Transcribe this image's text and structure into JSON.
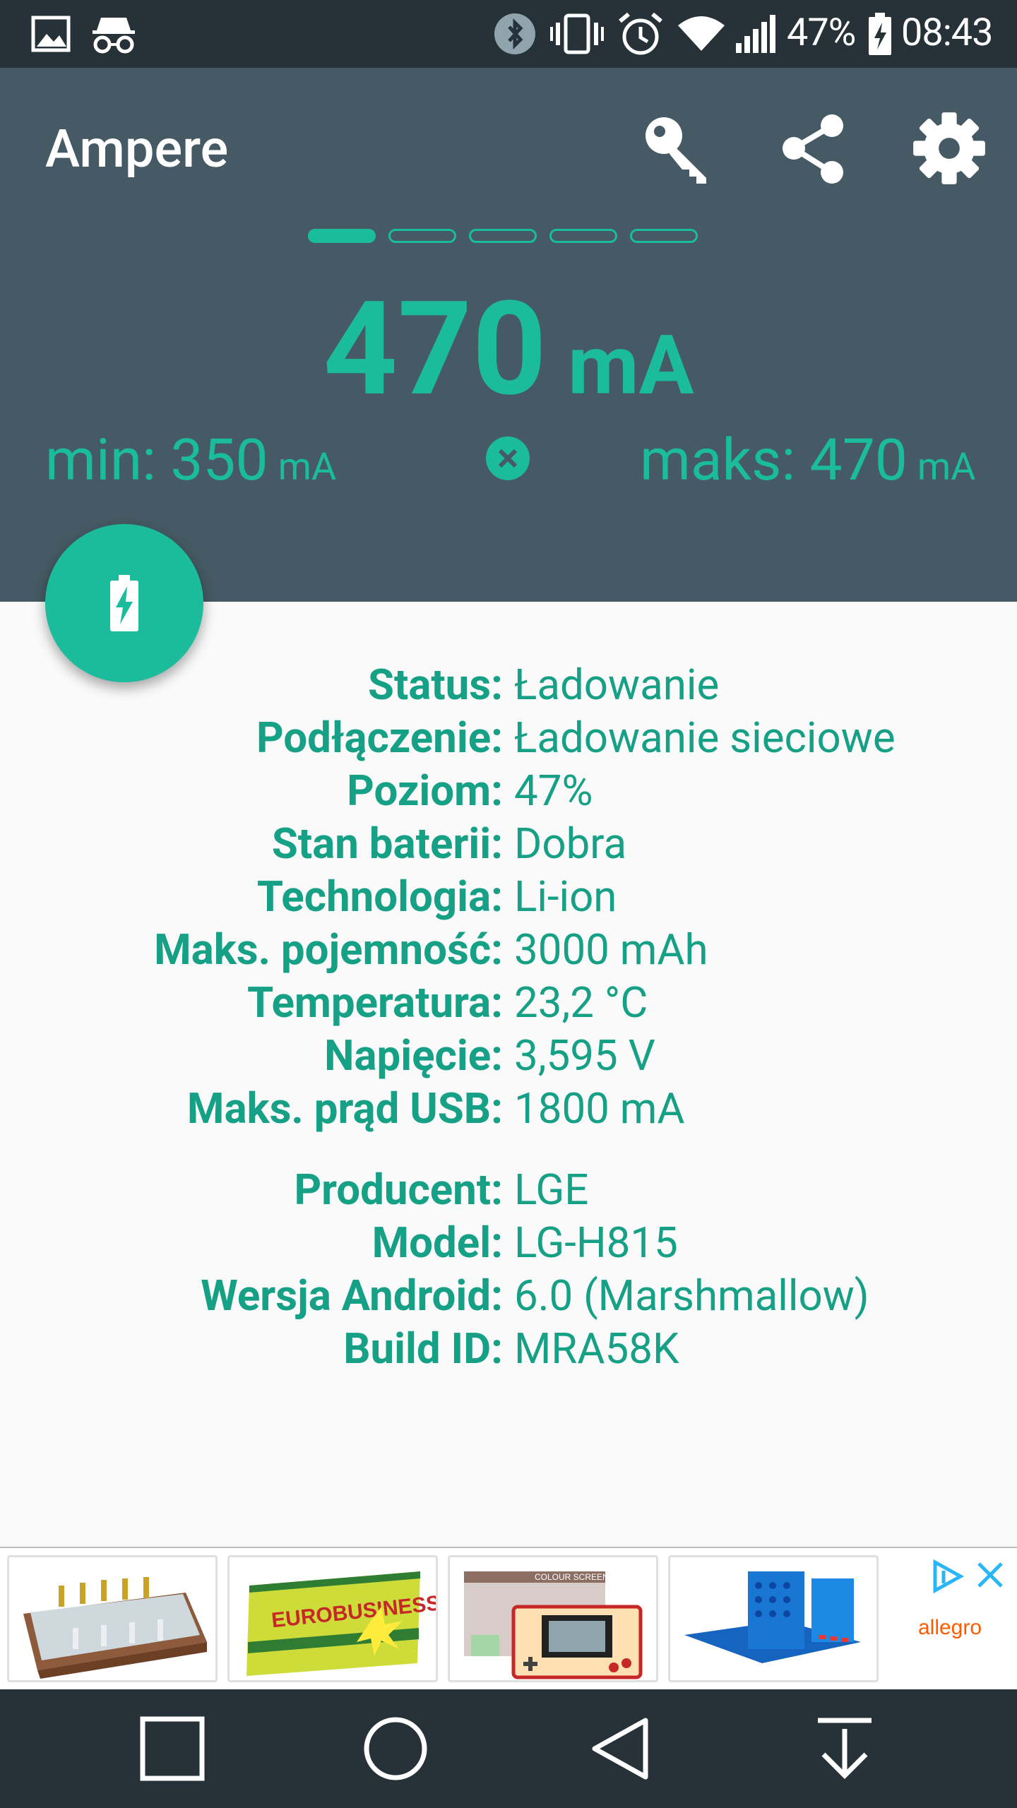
{
  "status_bar": {
    "battery_percent": "47%",
    "time": "08:43",
    "icons": [
      "image-icon",
      "incognito-icon",
      "bluetooth-icon",
      "vibrate-icon",
      "alarm-icon",
      "wifi-icon",
      "signal-icon",
      "battery-charging-icon"
    ]
  },
  "app_bar": {
    "title": "Ampere",
    "actions": [
      "key-icon",
      "share-icon",
      "gear-icon"
    ]
  },
  "pager": {
    "count": 5,
    "active_index": 0
  },
  "current": {
    "value": "470",
    "unit": "mA"
  },
  "min": {
    "label": "min:",
    "value": "350",
    "unit": "mA"
  },
  "max": {
    "label": "maks:",
    "value": "470",
    "unit": "mA"
  },
  "battery_info": [
    {
      "label": "Status:",
      "value": "Ładowanie"
    },
    {
      "label": "Podłączenie:",
      "value": "Ładowanie sieciowe"
    },
    {
      "label": "Poziom:",
      "value": "47%"
    },
    {
      "label": "Stan baterii:",
      "value": "Dobra"
    },
    {
      "label": "Technologia:",
      "value": "Li-ion"
    },
    {
      "label": "Maks. pojemność:",
      "value": "3000 mAh"
    },
    {
      "label": "Temperatura:",
      "value": "23,2 °C"
    },
    {
      "label": "Napięcie:",
      "value": "3,595 V"
    },
    {
      "label": "Maks. prąd USB:",
      "value": "1800 mA"
    }
  ],
  "device_info": [
    {
      "label": "Producent:",
      "value": "LGE"
    },
    {
      "label": "Model:",
      "value": "LG-H815"
    },
    {
      "label": "Wersja Android:",
      "value": "6.0 (Marshmallow)"
    },
    {
      "label": "Build ID:",
      "value": "MRA58K"
    }
  ],
  "ad": {
    "items": [
      {
        "name": "chess-set-image"
      },
      {
        "name": "eurobusiness-box-image",
        "text": "EUROBUSINESS"
      },
      {
        "name": "game-and-watch-image",
        "text": "COLOUR SCREEN"
      },
      {
        "name": "connect-four-game-image"
      }
    ],
    "brand": "allegro"
  },
  "colors": {
    "accent": "#1abc9c",
    "appbar": "#455a64",
    "statusbar": "#263238",
    "text_teal": "#16a085"
  }
}
